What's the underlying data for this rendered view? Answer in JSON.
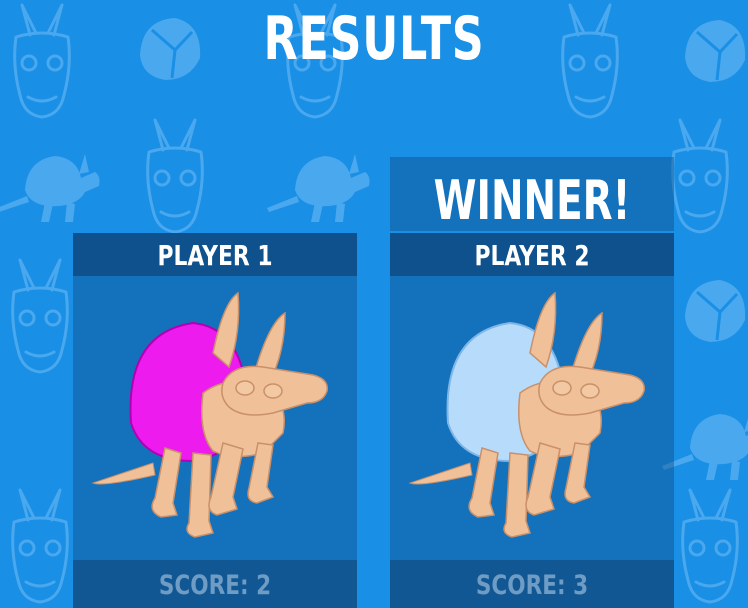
{
  "screen": {
    "title": "RESULTS",
    "winner_banner": "WINNER!",
    "winner_player_index": 1
  },
  "players": [
    {
      "name": "PLAYER 1",
      "score_text": "SCORE: 2",
      "shell_color": "#ee1bee"
    },
    {
      "name": "PLAYER 2",
      "score_text": "SCORE: 3",
      "shell_color": "#b7dcfb"
    }
  ],
  "colors": {
    "background": "#1a8fe6",
    "pattern": "#4aa8ef",
    "body": "#f0c098",
    "score_text": "#6f9cc4"
  },
  "icons": [
    "armadillo-head-icon",
    "armadillo-shell-icon",
    "armadillo-silhouette-icon"
  ]
}
